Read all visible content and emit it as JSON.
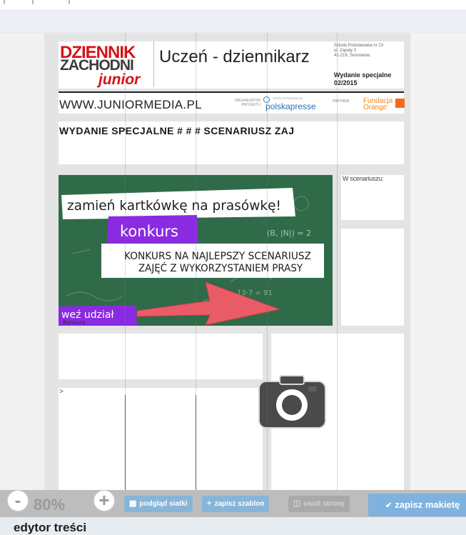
{
  "masthead": {
    "logo_line1": "DZIENNIK",
    "logo_line2": "ZACHODNI",
    "logo_line3": "junior",
    "title": "Uczeń - dziennikarz",
    "address": [
      "Szkoła Podstawowa nr 23",
      "ul. Zapały 3",
      "41-219, Sosnowiec"
    ],
    "edition": [
      "Wydanie specjalne",
      "02/2015"
    ]
  },
  "web_row": {
    "url": "WWW.JUNIORMEDIA.PL",
    "organizer_label": "ORGANIZATOR PROJEKTU",
    "organizer_tagline": "GRUPA WYDAWNICZA",
    "organizer_name": "polskapresse",
    "partner_label": "PARTNER",
    "partner_name": "Fundacja Orange"
  },
  "heading": "WYDANIE SPECJALNE # # # SCENARIUSZ ZAJ",
  "side_note": "W scenariuszu:",
  "banner": {
    "line1": "zamień kartkówkę na prasówkę!",
    "tag": "konkurs",
    "line2": "KONKURS NA NAJLEPSZY SCENARIUSZ",
    "line3": "ZAJĘĆ Z WYKORZYSTANIEM PRASY",
    "cta": "weź udział",
    "caption": "Konkurs",
    "formula": "(B, |N|) = 2",
    "board_note": "13·7 = 91"
  },
  "block_b": {
    "caret": ">"
  },
  "toolbar": {
    "zoom_minus": "-",
    "zoom_value": "80%",
    "zoom_plus": "+",
    "grid_preview": "podgląd siatki",
    "save_template": "zapisz szablon",
    "delete_page": "usuń stronę",
    "save_layout": "zapisz makietę"
  },
  "status": "edytor treści",
  "colors": {
    "board_green": "#2f6b48",
    "banner_purple": "#8a2be2",
    "brand_red": "#d51317",
    "toolbar_blue": "#86b5d8",
    "orange": "#f26b1d"
  },
  "icons": [
    "camera-icon",
    "grid-icon",
    "plus-icon",
    "trash-icon",
    "check-icon"
  ]
}
